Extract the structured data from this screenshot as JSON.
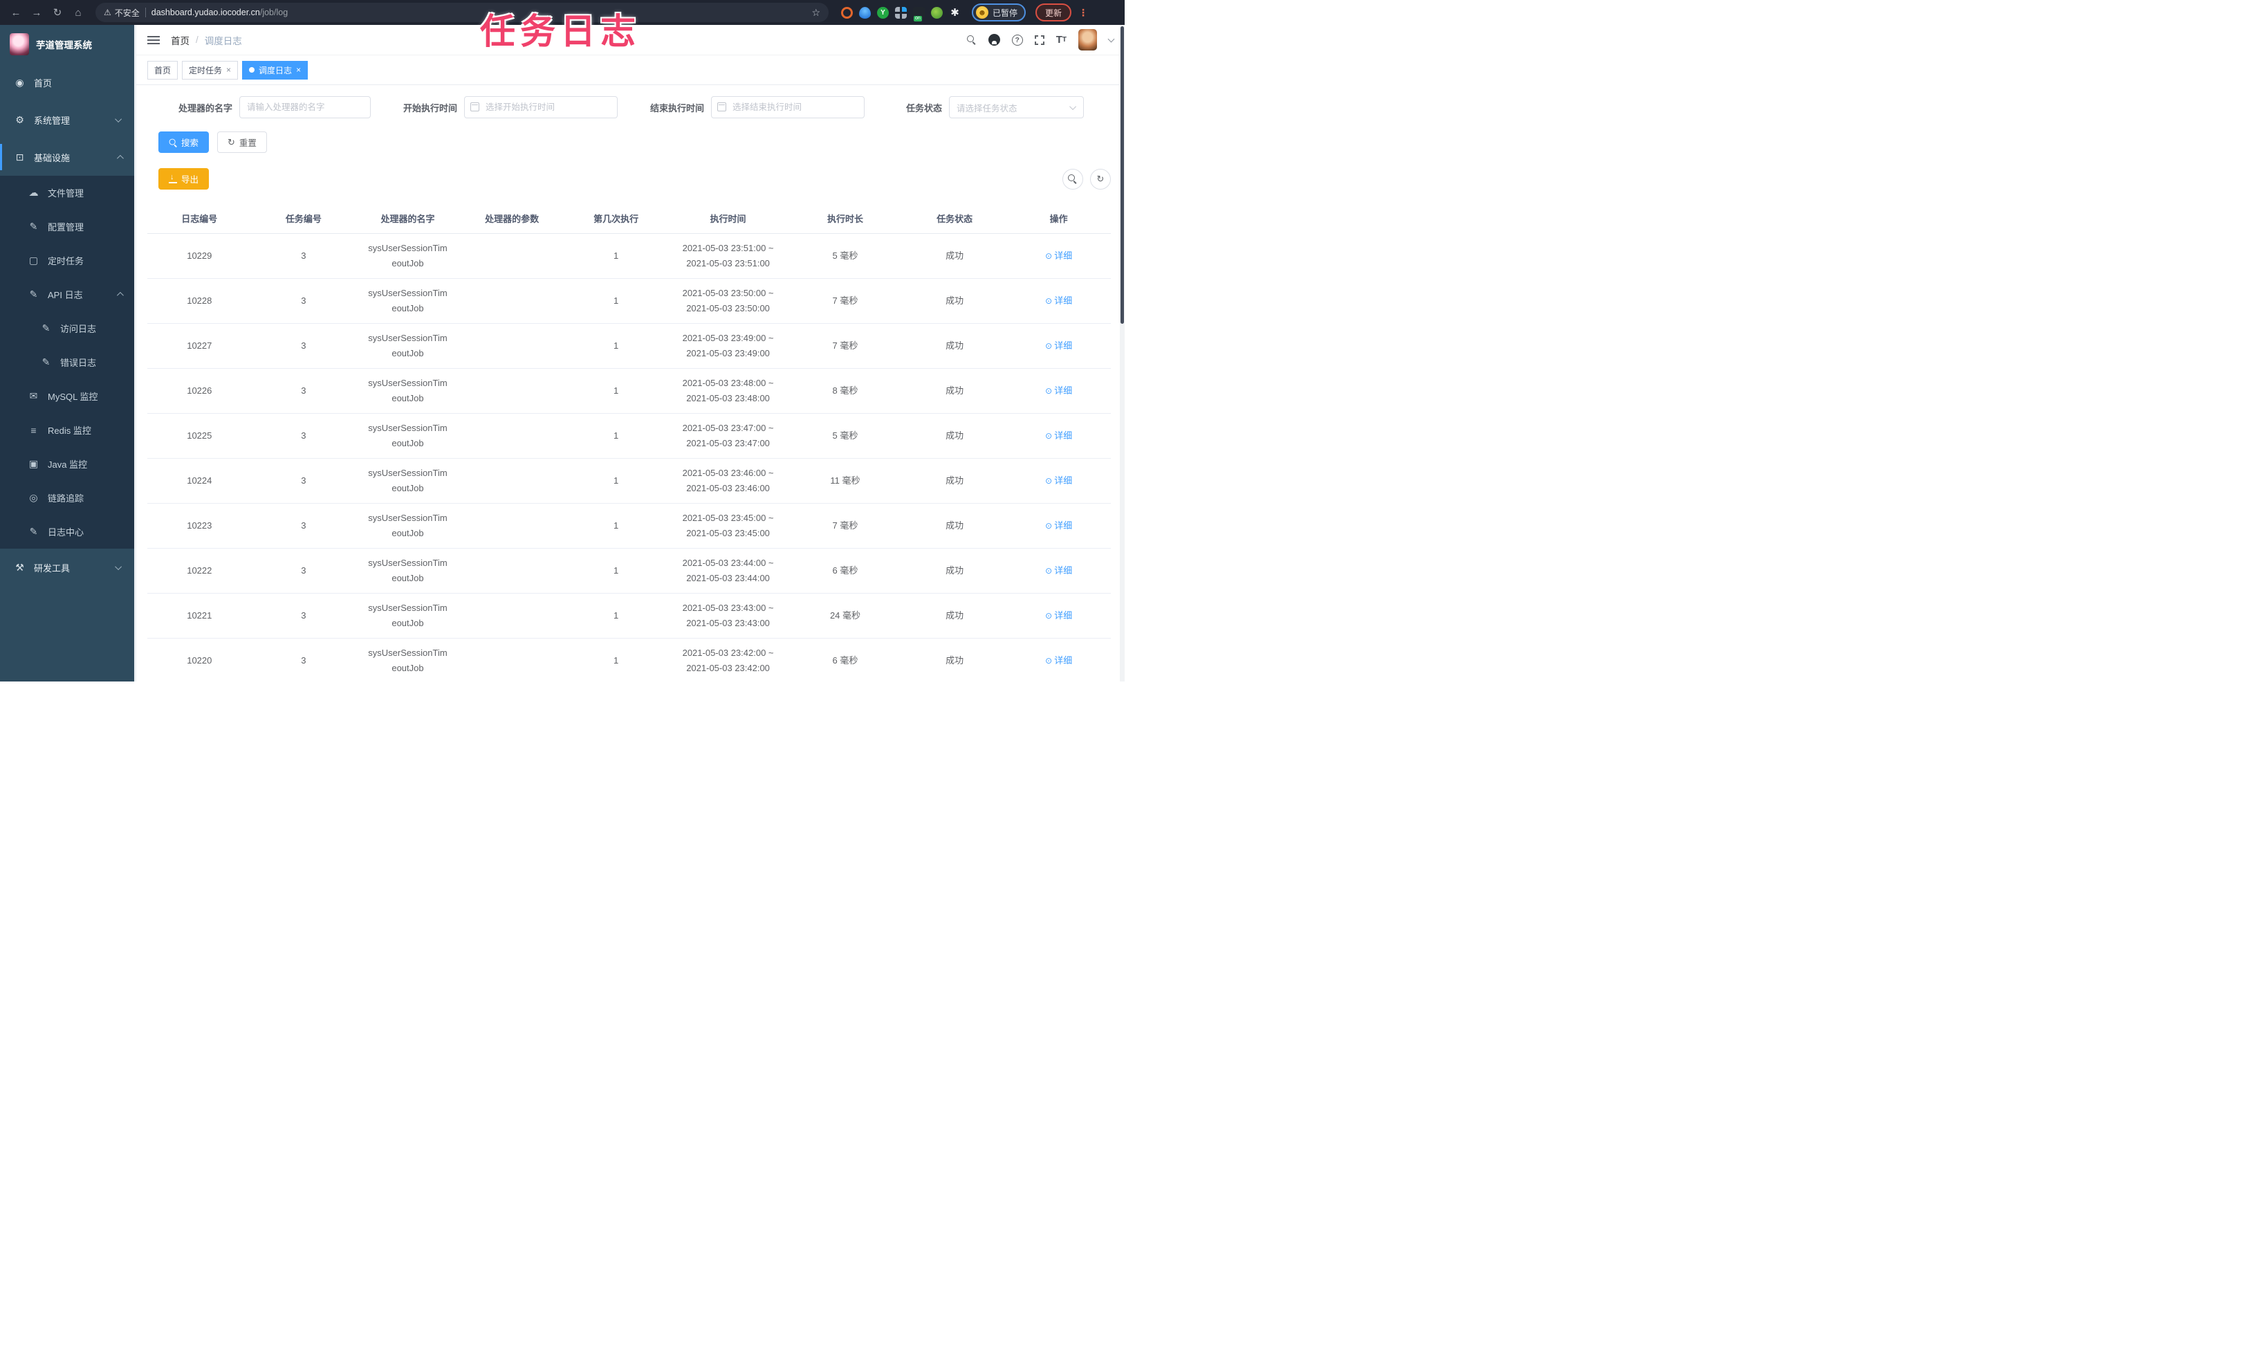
{
  "browser": {
    "security_label": "不安全",
    "url_host": "dashboard.yudao.iocoder.cn",
    "url_path": "/job/log",
    "paused_label": "已暂停",
    "update_label": "更新"
  },
  "annotation": {
    "text": "任务日志"
  },
  "colors": {
    "accent": "#409eff",
    "warning": "#f6ad12",
    "annotation_pink": "#f0416b",
    "sidebar_bg": "#2e4b5e",
    "sidebar_sub_bg": "#213447"
  },
  "sidebar": {
    "title": "芋道管理系统",
    "items": [
      {
        "name": "home",
        "label": "首页",
        "icon": "dashboard-icon",
        "level": 0,
        "zone": "light",
        "chevron": null,
        "active": false
      },
      {
        "name": "system-management",
        "label": "系统管理",
        "icon": "gear-icon",
        "level": 0,
        "zone": "light",
        "chevron": "down",
        "active": false
      },
      {
        "name": "infrastructure",
        "label": "基础设施",
        "icon": "monitor-icon",
        "level": 0,
        "zone": "light",
        "chevron": "up",
        "active": true
      },
      {
        "name": "file-management",
        "label": "文件管理",
        "icon": "cloud-upload-icon",
        "level": 1,
        "zone": "dark",
        "chevron": null,
        "active": false
      },
      {
        "name": "config-management",
        "label": "配置管理",
        "icon": "edit-square-icon",
        "level": 1,
        "zone": "dark",
        "chevron": null,
        "active": false
      },
      {
        "name": "scheduled-tasks",
        "label": "定时任务",
        "icon": "task-icon",
        "level": 1,
        "zone": "dark",
        "chevron": null,
        "active": false
      },
      {
        "name": "api-log",
        "label": "API 日志",
        "icon": "edit-square-icon",
        "level": 1,
        "zone": "dark",
        "chevron": "up",
        "active": false
      },
      {
        "name": "access-log",
        "label": "访问日志",
        "icon": "edit-square-icon",
        "level": 2,
        "zone": "dark",
        "chevron": null,
        "active": false
      },
      {
        "name": "error-log",
        "label": "错误日志",
        "icon": "edit-square-icon",
        "level": 2,
        "zone": "dark",
        "chevron": null,
        "active": false
      },
      {
        "name": "mysql-monitor",
        "label": "MySQL 监控",
        "icon": "image-icon",
        "level": 1,
        "zone": "dark",
        "chevron": null,
        "active": false
      },
      {
        "name": "redis-monitor",
        "label": "Redis 监控",
        "icon": "layers-icon",
        "level": 1,
        "zone": "dark",
        "chevron": null,
        "active": false
      },
      {
        "name": "java-monitor",
        "label": "Java 监控",
        "icon": "screen-icon",
        "level": 1,
        "zone": "dark",
        "chevron": null,
        "active": false
      },
      {
        "name": "trace",
        "label": "链路追踪",
        "icon": "eye-icon",
        "level": 1,
        "zone": "dark",
        "chevron": null,
        "active": false
      },
      {
        "name": "log-center",
        "label": "日志中心",
        "icon": "edit-square-icon",
        "level": 1,
        "zone": "dark",
        "chevron": null,
        "active": false
      },
      {
        "name": "dev-tools",
        "label": "研发工具",
        "icon": "toolbox-icon",
        "level": 0,
        "zone": "light",
        "chevron": "down",
        "active": false
      }
    ]
  },
  "header": {
    "breadcrumb": [
      "首页",
      "调度日志"
    ]
  },
  "tabs": [
    {
      "name": "home",
      "label": "首页",
      "closable": false,
      "active": false
    },
    {
      "name": "scheduled-tasks",
      "label": "定时任务",
      "closable": true,
      "active": false
    },
    {
      "name": "schedule-log",
      "label": "调度日志",
      "closable": true,
      "active": true
    }
  ],
  "filters": {
    "handler_name": {
      "label": "处理器的名字",
      "value": "",
      "placeholder": "请输入处理器的名字"
    },
    "begin_time": {
      "label": "开始执行时间",
      "value": "",
      "placeholder": "选择开始执行时间"
    },
    "end_time": {
      "label": "结束执行时间",
      "value": "",
      "placeholder": "选择结束执行时间"
    },
    "status": {
      "label": "任务状态",
      "value": "",
      "placeholder": "请选择任务状态"
    },
    "search_label": "搜索",
    "reset_label": "重置",
    "export_label": "导出"
  },
  "table": {
    "columns": [
      "日志编号",
      "任务编号",
      "处理器的名字",
      "处理器的参数",
      "第几次执行",
      "执行时间",
      "执行时长",
      "任务状态",
      "操作"
    ],
    "action_label": "详细",
    "rows": [
      {
        "log_id": "10229",
        "job_id": "3",
        "handler_line1": "sysUserSessionTim",
        "handler_line2": "eoutJob",
        "param": "",
        "execute_index": "1",
        "time_line1": "2021-05-03 23:51:00 ~",
        "time_line2": "2021-05-03 23:51:00",
        "duration": "5 毫秒",
        "status": "成功"
      },
      {
        "log_id": "10228",
        "job_id": "3",
        "handler_line1": "sysUserSessionTim",
        "handler_line2": "eoutJob",
        "param": "",
        "execute_index": "1",
        "time_line1": "2021-05-03 23:50:00 ~",
        "time_line2": "2021-05-03 23:50:00",
        "duration": "7 毫秒",
        "status": "成功"
      },
      {
        "log_id": "10227",
        "job_id": "3",
        "handler_line1": "sysUserSessionTim",
        "handler_line2": "eoutJob",
        "param": "",
        "execute_index": "1",
        "time_line1": "2021-05-03 23:49:00 ~",
        "time_line2": "2021-05-03 23:49:00",
        "duration": "7 毫秒",
        "status": "成功"
      },
      {
        "log_id": "10226",
        "job_id": "3",
        "handler_line1": "sysUserSessionTim",
        "handler_line2": "eoutJob",
        "param": "",
        "execute_index": "1",
        "time_line1": "2021-05-03 23:48:00 ~",
        "time_line2": "2021-05-03 23:48:00",
        "duration": "8 毫秒",
        "status": "成功"
      },
      {
        "log_id": "10225",
        "job_id": "3",
        "handler_line1": "sysUserSessionTim",
        "handler_line2": "eoutJob",
        "param": "",
        "execute_index": "1",
        "time_line1": "2021-05-03 23:47:00 ~",
        "time_line2": "2021-05-03 23:47:00",
        "duration": "5 毫秒",
        "status": "成功"
      },
      {
        "log_id": "10224",
        "job_id": "3",
        "handler_line1": "sysUserSessionTim",
        "handler_line2": "eoutJob",
        "param": "",
        "execute_index": "1",
        "time_line1": "2021-05-03 23:46:00 ~",
        "time_line2": "2021-05-03 23:46:00",
        "duration": "11 毫秒",
        "status": "成功"
      },
      {
        "log_id": "10223",
        "job_id": "3",
        "handler_line1": "sysUserSessionTim",
        "handler_line2": "eoutJob",
        "param": "",
        "execute_index": "1",
        "time_line1": "2021-05-03 23:45:00 ~",
        "time_line2": "2021-05-03 23:45:00",
        "duration": "7 毫秒",
        "status": "成功"
      },
      {
        "log_id": "10222",
        "job_id": "3",
        "handler_line1": "sysUserSessionTim",
        "handler_line2": "eoutJob",
        "param": "",
        "execute_index": "1",
        "time_line1": "2021-05-03 23:44:00 ~",
        "time_line2": "2021-05-03 23:44:00",
        "duration": "6 毫秒",
        "status": "成功"
      },
      {
        "log_id": "10221",
        "job_id": "3",
        "handler_line1": "sysUserSessionTim",
        "handler_line2": "eoutJob",
        "param": "",
        "execute_index": "1",
        "time_line1": "2021-05-03 23:43:00 ~",
        "time_line2": "2021-05-03 23:43:00",
        "duration": "24 毫秒",
        "status": "成功"
      },
      {
        "log_id": "10220",
        "job_id": "3",
        "handler_line1": "sysUserSessionTim",
        "handler_line2": "eoutJob",
        "param": "",
        "execute_index": "1",
        "time_line1": "2021-05-03 23:42:00 ~",
        "time_line2": "2021-05-03 23:42:00",
        "duration": "6 毫秒",
        "status": "成功"
      }
    ]
  }
}
